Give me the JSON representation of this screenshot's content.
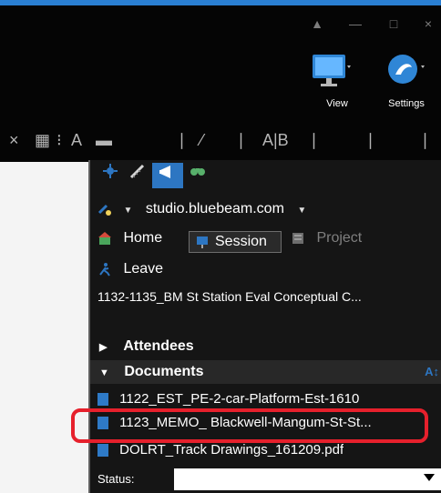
{
  "ribbon": {
    "window_controls": [
      "▲",
      "—",
      "□",
      "×"
    ],
    "view_label": "View",
    "settings_label": "Settings",
    "tool_glyphs": [
      "×",
      "▦",
      "⁝",
      "A",
      "▬",
      "∣",
      "⁄",
      "∣",
      "A|B",
      "∣",
      "∣",
      "∣"
    ]
  },
  "panel": {
    "tabs": [
      "gear-icon",
      "ruler-icon",
      "megaphone-icon",
      "binoculars-icon"
    ],
    "server": "studio.bluebeam.com",
    "nav": {
      "home": "Home",
      "session": "Session",
      "project": "Project"
    },
    "leave": "Leave",
    "session_title": "1132-1135_BM St Station Eval Conceptual C...",
    "status_label": "Status:",
    "status_value": "",
    "attendees": "Attendees",
    "documents": "Documents",
    "documents_action": "A↕",
    "docs": [
      "1122_EST_PE-2-car-Platform-Est-1610",
      "1123_MEMO_ Blackwell-Mangum-St-St...",
      "DOLRT_Track Drawings_161209.pdf"
    ]
  },
  "colors": {
    "accent": "#2d76c2",
    "highlight": "#e6202c",
    "panel_bg": "#151515",
    "topbar_bg": "#050505"
  }
}
